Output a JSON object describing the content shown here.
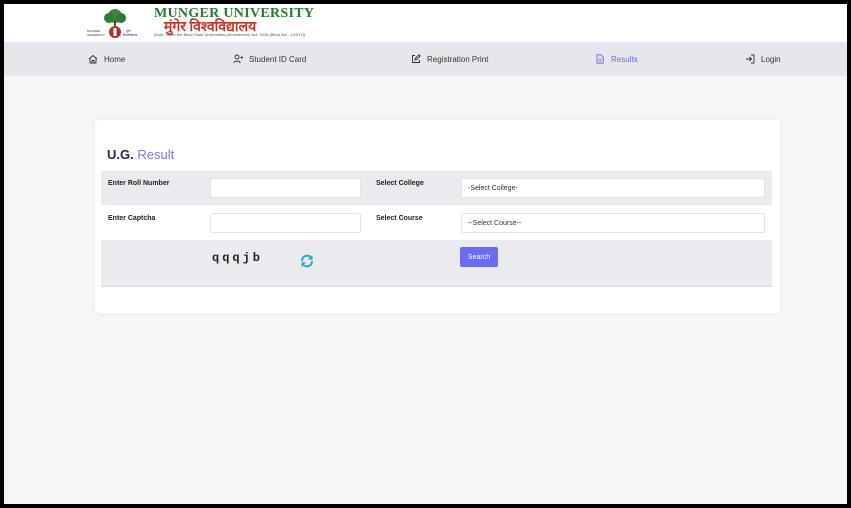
{
  "header": {
    "logo_title_en": "MUNGER UNIVERSITY",
    "logo_title_hi": "मुंगेर विश्वविद्यालय",
    "logo_subtitle": "(Estd. under the Bihar State Universities (Amendment) Act, 2016 (Bihar Act - 1/2017))",
    "emblem_text": "MUNGER UNIVERSITY"
  },
  "nav": {
    "items": [
      {
        "label": "Home",
        "icon": "home-icon"
      },
      {
        "label": "Student ID Card",
        "icon": "user-plus-icon"
      },
      {
        "label": "Registration Print",
        "icon": "edit-icon"
      },
      {
        "label": "Results",
        "icon": "document-icon",
        "active": true
      },
      {
        "label": "Login",
        "icon": "login-icon"
      }
    ]
  },
  "form": {
    "title_bold": "U.G.",
    "title_rest": "Result",
    "roll_label": "Enter Roll Number",
    "roll_value": "",
    "college_label": "Select College",
    "college_selected": "-Select College-",
    "captcha_label": "Enter Captcha",
    "captcha_value": "",
    "course_label": "Select Course",
    "course_selected": "--Select Course--",
    "captcha_text": "qqqjb",
    "search_label": "Search"
  },
  "colors": {
    "accent": "#6c6cf0",
    "active_nav": "#6c63e8",
    "logo_green": "#2a7a34",
    "logo_red": "#c0392b"
  }
}
